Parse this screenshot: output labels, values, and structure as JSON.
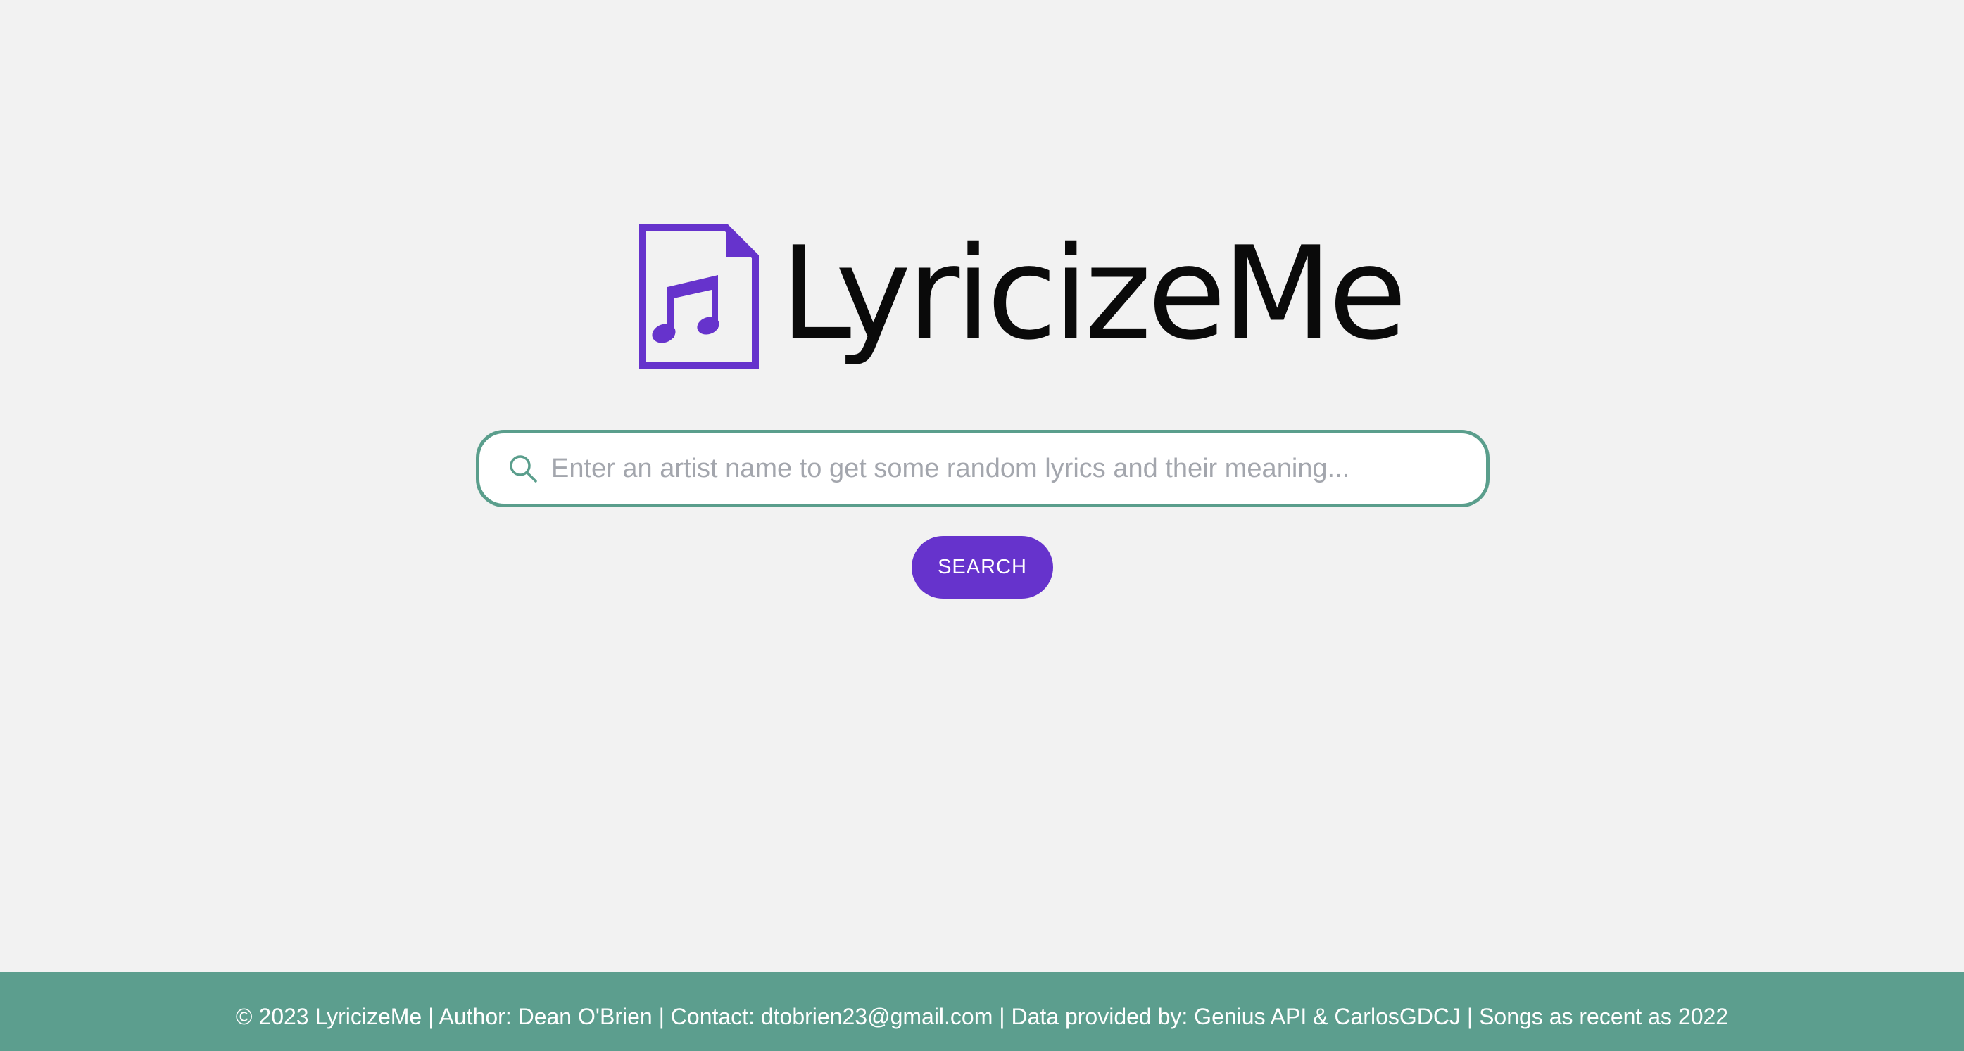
{
  "brand": {
    "name": "LyricizeMe",
    "logo_icon": "music-file-icon",
    "accent_color": "#6633cc"
  },
  "search": {
    "icon": "search-icon",
    "placeholder": "Enter an artist name to get some random lyrics and their meaning...",
    "value": "",
    "border_color": "#5a9e8c",
    "button_label": "SEARCH"
  },
  "footer": {
    "text": "© 2023 LyricizeMe | Author: Dean O'Brien | Contact: dtobrien23@gmail.com | Data provided by: Genius API & CarlosGDCJ | Songs as recent as 2022",
    "background_color": "#5c9e8e"
  }
}
